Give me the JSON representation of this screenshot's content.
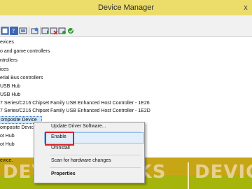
{
  "window": {
    "title": "Device Manager",
    "close_glyph": "x"
  },
  "toolbar": {
    "icons": [
      "properties-icon",
      "help-icon",
      "show-hidden-icon",
      "scan-hardware-icon",
      "update-driver-icon",
      "uninstall-icon",
      "disable-icon",
      "enable-icon"
    ]
  },
  "tree": {
    "rows": [
      "evices",
      "o and game controllers",
      "ntrollers",
      "ices",
      "erial Bus controllers",
      " USB Hub",
      " USB Hub",
      "7 Series/C216 Chipset Family USB Enhanced Host Controller - 1E26",
      "7 Series/C216 Chipset Family USB Enhanced Host Controller - 1E2D",
      "omposite Device",
      "omposite Devic",
      "ot Hub",
      "ot Hub"
    ]
  },
  "context_menu": {
    "items": {
      "update_driver": "Update Driver Software...",
      "enable": "Enable",
      "uninstall": "Uninstall",
      "scan": "Scan for hardware changes",
      "properties": "Properties"
    }
  },
  "status": {
    "text": "evice."
  },
  "watermark": {
    "left": "DEVICE TRICKS",
    "right": "DEVIC"
  },
  "colors": {
    "titlebar": "#ecdd6a",
    "selection": "#cce8ff",
    "menu_highlight": "#e2eef9",
    "annotation_red": "#d8212b",
    "statusbar": "#c7a616",
    "watermark_strip": "#a6b50c"
  }
}
